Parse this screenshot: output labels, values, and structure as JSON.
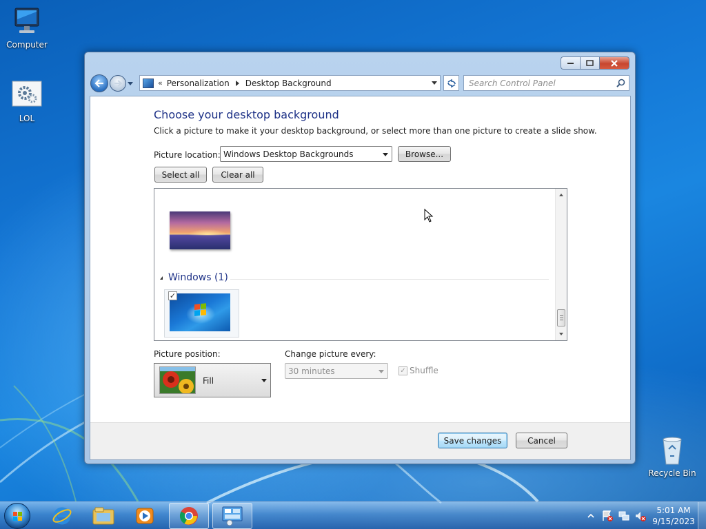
{
  "desktop": {
    "icons": [
      {
        "label": "Computer"
      },
      {
        "label": "LOL"
      },
      {
        "label": "Recycle Bin"
      }
    ]
  },
  "window": {
    "breadcrumb": {
      "chevron": "«",
      "items": [
        "Personalization",
        "Desktop Background"
      ]
    },
    "search_placeholder": "Search Control Panel",
    "heading": "Choose your desktop background",
    "description": "Click a picture to make it your desktop background, or select more than one picture to create a slide show.",
    "picture_location_label": "Picture location:",
    "picture_location_value": "Windows Desktop Backgrounds",
    "browse_label": "Browse...",
    "select_all_label": "Select all",
    "clear_all_label": "Clear all",
    "gallery": {
      "group_title": "Windows (1)",
      "windows_thumb_checked": "✓"
    },
    "picture_position_label": "Picture position:",
    "picture_position_value": "Fill",
    "change_every_label": "Change picture every:",
    "change_every_value": "30 minutes",
    "shuffle_label": "Shuffle",
    "shuffle_check": "✓",
    "save_label": "Save changes",
    "cancel_label": "Cancel"
  },
  "taskbar": {
    "apps": [
      "start-orb",
      "internet-explorer-icon",
      "file-explorer-icon",
      "media-player-icon",
      "chrome-icon",
      "control-panel-icon"
    ],
    "time": "5:01 AM",
    "date": "9/15/2023"
  },
  "colors": {
    "heading": "#1e3287",
    "desktop_blue": "#1477d6",
    "close_red": "#c7462f"
  }
}
